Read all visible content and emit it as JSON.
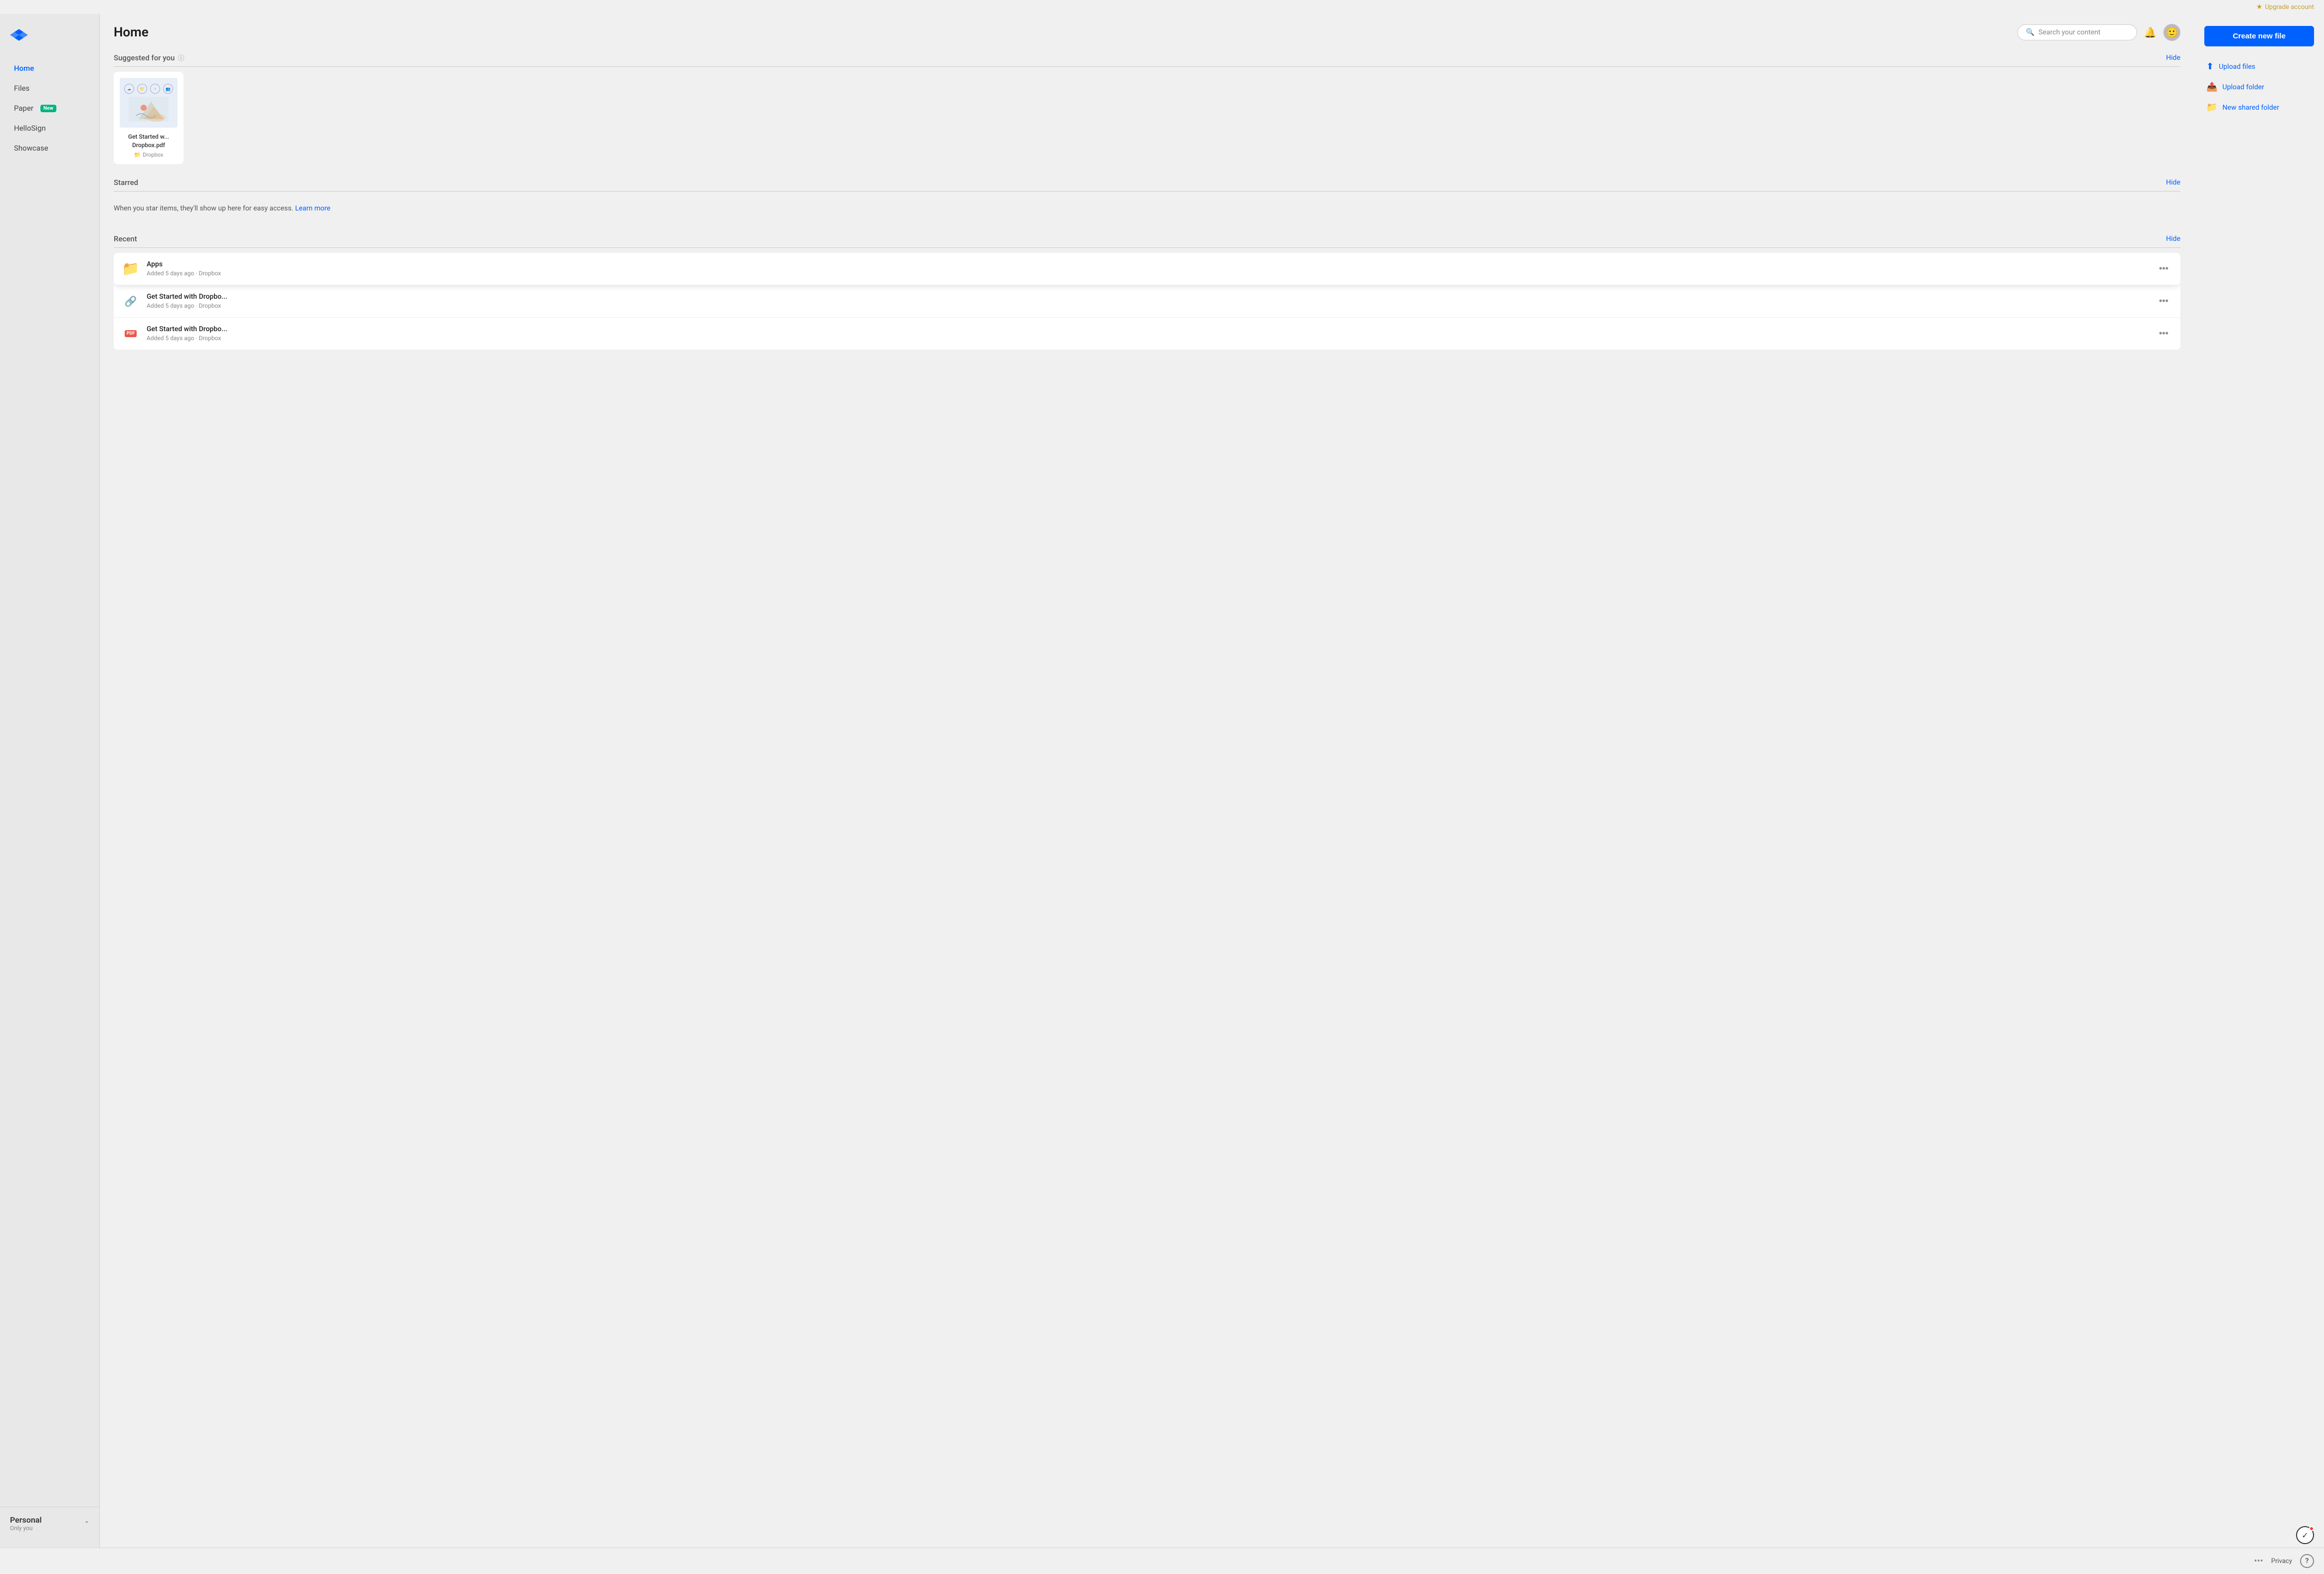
{
  "topbar": {
    "upgrade_label": "Upgrade account"
  },
  "sidebar": {
    "nav_items": [
      {
        "id": "home",
        "label": "Home",
        "active": true,
        "badge": null
      },
      {
        "id": "files",
        "label": "Files",
        "active": false,
        "badge": null
      },
      {
        "id": "paper",
        "label": "Paper",
        "active": false,
        "badge": "New"
      },
      {
        "id": "hellosign",
        "label": "HelloSign",
        "active": false,
        "badge": null
      },
      {
        "id": "showcase",
        "label": "Showcase",
        "active": false,
        "badge": null
      }
    ],
    "account": {
      "name": "Personal",
      "subtitle": "Only you"
    }
  },
  "header": {
    "title": "Home",
    "search_placeholder": "Search your content"
  },
  "suggested": {
    "title": "Suggested for you",
    "hide_label": "Hide",
    "card": {
      "name": "Get Started w... Dropbox.pdf",
      "folder": "Dropbox"
    }
  },
  "starred": {
    "title": "Starred",
    "hide_label": "Hide",
    "empty_text": "When you star items, they'll show up here for easy access.",
    "learn_more": "Learn more"
  },
  "recent": {
    "title": "Recent",
    "hide_label": "Hide",
    "items": [
      {
        "id": "apps",
        "name": "Apps",
        "meta": "Added 5 days ago · Dropbox",
        "type": "folder"
      },
      {
        "id": "link1",
        "name": "Get Started with Dropbo...",
        "meta": "Added 5 days ago · Dropbox",
        "type": "link"
      },
      {
        "id": "pdf1",
        "name": "Get Started with Dropbo...",
        "meta": "Added 5 days ago · Dropbox",
        "type": "pdf"
      }
    ]
  },
  "actions": {
    "create_new_file": "Create new file",
    "upload_files": "Upload files",
    "upload_folder": "Upload folder",
    "new_shared_folder": "New shared folder"
  },
  "footer": {
    "privacy": "Privacy",
    "help": "?"
  }
}
